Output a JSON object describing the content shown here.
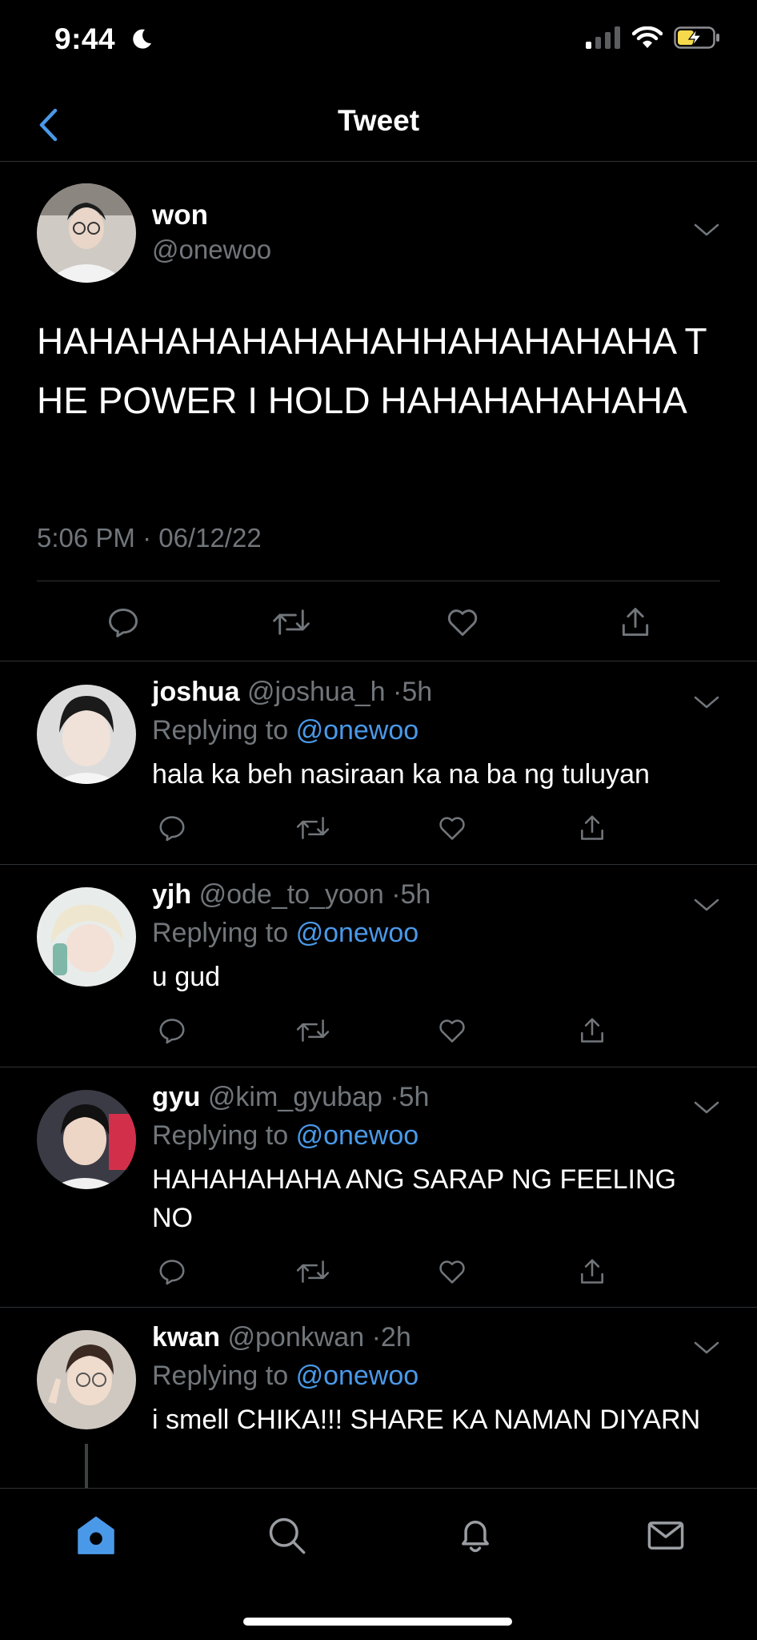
{
  "status_bar": {
    "time": "9:44",
    "icons": [
      "moon-icon",
      "cellular-signal-icon",
      "wifi-icon",
      "battery-charging-icon"
    ]
  },
  "nav": {
    "title": "Tweet",
    "back_icon": "chevron-left-icon"
  },
  "colors": {
    "background": "#000000",
    "text_primary": "#ffffff",
    "text_secondary": "#71767b",
    "accent": "#4a99e9",
    "divider": "#2f3336",
    "battery_charging": "#f7d94c"
  },
  "main_tweet": {
    "name": "won",
    "handle": "@onewoo",
    "text": "HAHAHAHAHAHAHAHHAHAHAHAHA THE POWER I HOLD HAHAHAHAHAHA",
    "timestamp": "5:06 PM · 06/12/22",
    "actions": [
      "reply-icon",
      "retweet-icon",
      "like-icon",
      "share-icon"
    ]
  },
  "replies": [
    {
      "name": "joshua",
      "handle": "@joshua_h",
      "time": "5h",
      "replying_label": "Replying to",
      "replying_to": "@onewoo",
      "text": "hala ka beh nasiraan ka na ba ng tuluyan"
    },
    {
      "name": "yjh",
      "handle": "@ode_to_yoon",
      "time": "5h",
      "replying_label": "Replying to",
      "replying_to": "@onewoo",
      "text": "u gud"
    },
    {
      "name": "gyu",
      "handle": "@kim_gyubap",
      "time": "5h",
      "replying_label": "Replying to",
      "replying_to": "@onewoo",
      "text": "HAHAHAHAHA ANG SARAP NG FEELING NO"
    },
    {
      "name": "kwan",
      "handle": "@ponkwan",
      "time": "2h",
      "replying_label": "Replying to",
      "replying_to": "@onewoo",
      "text": "i smell CHIKA!!! SHARE KA NAMAN DIYARN"
    }
  ],
  "tab_bar": {
    "items": [
      "home-icon",
      "search-icon",
      "notifications-icon",
      "messages-icon"
    ],
    "active": "home-icon"
  }
}
